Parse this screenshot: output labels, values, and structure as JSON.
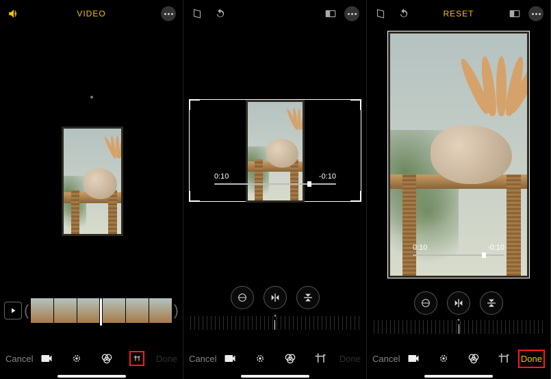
{
  "panel1": {
    "topbar": {
      "title": "VIDEO"
    },
    "bottombar": {
      "cancel": "Cancel",
      "done": "Done"
    }
  },
  "panel2": {
    "times": {
      "left": "0:10",
      "right": "-0:10"
    },
    "bottombar": {
      "cancel": "Cancel",
      "done": "Done"
    }
  },
  "panel3": {
    "topbar": {
      "reset": "RESET"
    },
    "times": {
      "left": "0:10",
      "right": "-0:10"
    },
    "bottombar": {
      "cancel": "Cancel",
      "done": "Done"
    }
  },
  "icons": {
    "sound": "sound-icon",
    "more": "more-icon",
    "aspect": "aspect-ratio-icon",
    "skew": "skew-icon",
    "rotate": "rotate-icon",
    "straighten": "straighten-icon",
    "fliph": "flip-horizontal-icon",
    "flipv": "flip-vertical-icon",
    "video": "video-mode-icon",
    "adjust": "adjust-icon",
    "filters": "filters-icon",
    "crop": "crop-icon",
    "play": "play-icon"
  }
}
